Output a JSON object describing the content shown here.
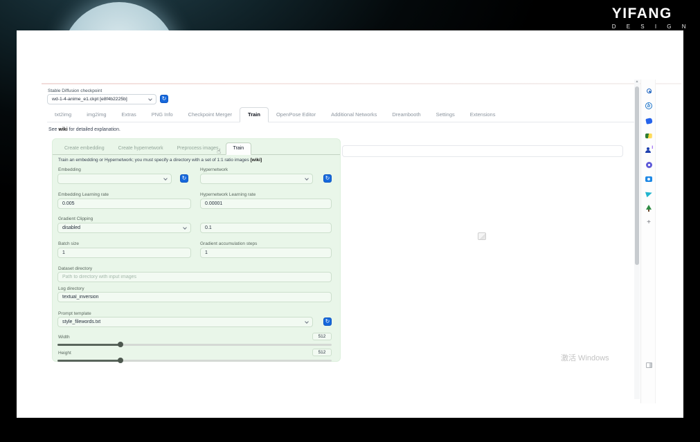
{
  "brand": {
    "name": "YIFANG",
    "subtitle": "D E S I G N"
  },
  "checkpoint": {
    "label": "Stable Diffusion checkpoint",
    "value": "wd-1-4-anime_e1.ckpt [e8f4b2225b]"
  },
  "main_tabs": [
    {
      "label": "txt2img"
    },
    {
      "label": "img2img"
    },
    {
      "label": "Extras"
    },
    {
      "label": "PNG Info"
    },
    {
      "label": "Checkpoint Merger"
    },
    {
      "label": "Train"
    },
    {
      "label": "OpenPose Editor"
    },
    {
      "label": "Additional Networks"
    },
    {
      "label": "Dreambooth"
    },
    {
      "label": "Settings"
    },
    {
      "label": "Extensions"
    }
  ],
  "wiki_note": {
    "pre": "See ",
    "link": "wiki",
    "post": " for detailed explanation."
  },
  "train_panel": {
    "subtabs": [
      {
        "label": "Create embedding"
      },
      {
        "label": "Create hypernetwork"
      },
      {
        "label": "Preprocess images"
      },
      {
        "label": "Train"
      }
    ],
    "description": "Train an embedding or Hypernetwork; you must specify a directory with a set of 1:1 ratio images ",
    "description_wiki": "[wiki]",
    "embedding": {
      "label": "Embedding",
      "value": ""
    },
    "hypernetwork": {
      "label": "Hypernetwork",
      "value": ""
    },
    "embedding_lr": {
      "label": "Embedding Learning rate",
      "value": "0.005"
    },
    "hypernetwork_lr": {
      "label": "Hypernetwork Learning rate",
      "value": "0.00001"
    },
    "gradient_clipping": {
      "label": "Gradient Clipping",
      "value": "disabled"
    },
    "gradient_clipping_value": {
      "value": "0.1"
    },
    "batch_size": {
      "label": "Batch size",
      "value": "1"
    },
    "gradient_accumulation": {
      "label": "Gradient accumulation steps",
      "value": "1"
    },
    "dataset_directory": {
      "label": "Dataset directory",
      "placeholder": "Path to directory with input images"
    },
    "log_directory": {
      "label": "Log directory",
      "value": "textual_inversion"
    },
    "prompt_template": {
      "label": "Prompt template",
      "value": "style_filewords.txt"
    },
    "width": {
      "label": "Width",
      "value": "512"
    },
    "height": {
      "label": "Height",
      "value": "512"
    }
  },
  "output": {
    "textbox_value": ""
  },
  "watermark": "激活 Windows",
  "icons": {
    "refresh_glyph": "↻",
    "cursor_glyph": "☝",
    "scroll_up_glyph": "▲",
    "plus_glyph": "+",
    "bing_glyph": "b",
    "translate_sup_glyph": "I"
  },
  "colors": {
    "accent_blue": "#1668dc",
    "panel_green": "#e9f6e9",
    "page_bg": "#ffffff"
  }
}
